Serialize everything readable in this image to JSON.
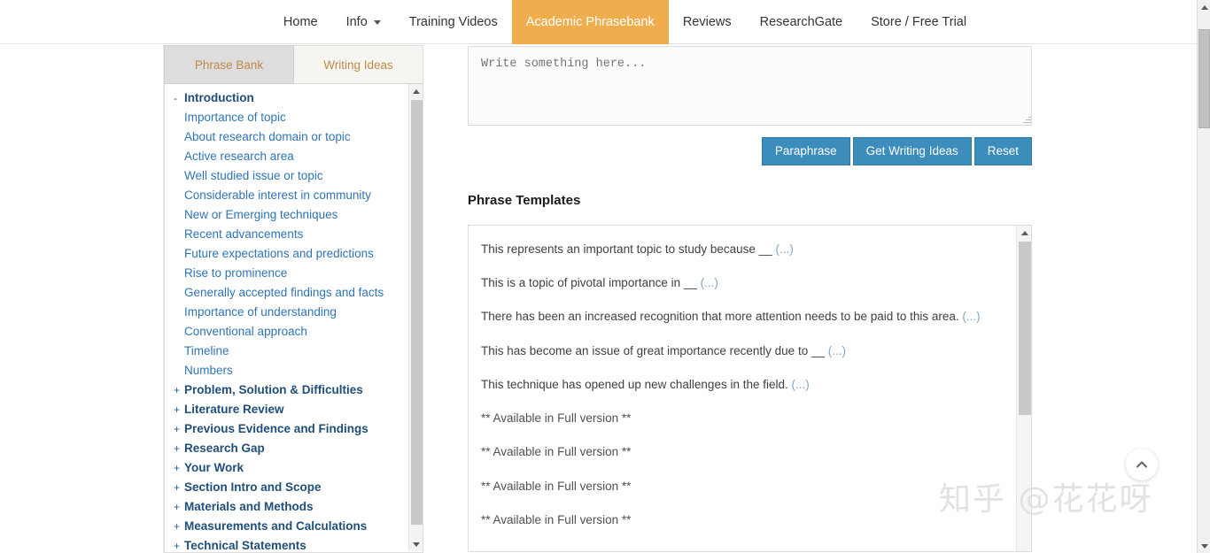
{
  "nav": {
    "items": [
      {
        "label": "Home",
        "active": false,
        "has_caret": false
      },
      {
        "label": "Info",
        "active": false,
        "has_caret": true
      },
      {
        "label": "Training Videos",
        "active": false,
        "has_caret": false
      },
      {
        "label": "Academic Phrasebank",
        "active": true,
        "has_caret": false
      },
      {
        "label": "Reviews",
        "active": false,
        "has_caret": false
      },
      {
        "label": "ResearchGate",
        "active": false,
        "has_caret": false
      },
      {
        "label": "Store / Free Trial",
        "active": false,
        "has_caret": false
      }
    ],
    "active_color": "#F0AD4E"
  },
  "sidebar": {
    "tabs": [
      {
        "label": "Phrase Bank",
        "active": true
      },
      {
        "label": "Writing Ideas",
        "active": false
      }
    ],
    "items": [
      {
        "label": "Introduction",
        "type": "group",
        "marker": "-"
      },
      {
        "label": "Importance of topic",
        "type": "child",
        "marker": ""
      },
      {
        "label": "About research domain or topic",
        "type": "child",
        "marker": ""
      },
      {
        "label": "Active research area",
        "type": "child",
        "marker": ""
      },
      {
        "label": "Well studied issue or topic",
        "type": "child",
        "marker": ""
      },
      {
        "label": "Considerable interest in community",
        "type": "child",
        "marker": ""
      },
      {
        "label": "New or Emerging techniques",
        "type": "child",
        "marker": ""
      },
      {
        "label": "Recent advancements",
        "type": "child",
        "marker": ""
      },
      {
        "label": "Future expectations and predictions",
        "type": "child",
        "marker": ""
      },
      {
        "label": "Rise to prominence",
        "type": "child",
        "marker": ""
      },
      {
        "label": "Generally accepted findings and facts",
        "type": "child",
        "marker": ""
      },
      {
        "label": "Importance of understanding",
        "type": "child",
        "marker": ""
      },
      {
        "label": "Conventional approach",
        "type": "child",
        "marker": ""
      },
      {
        "label": "Timeline",
        "type": "child",
        "marker": ""
      },
      {
        "label": "Numbers",
        "type": "child",
        "marker": ""
      },
      {
        "label": "Problem, Solution & Difficulties",
        "type": "group",
        "marker": "+"
      },
      {
        "label": "Literature Review",
        "type": "group",
        "marker": "+"
      },
      {
        "label": "Previous Evidence and Findings",
        "type": "group",
        "marker": "+"
      },
      {
        "label": "Research Gap",
        "type": "group",
        "marker": "+"
      },
      {
        "label": "Your Work",
        "type": "group",
        "marker": "+"
      },
      {
        "label": "Section Intro and Scope",
        "type": "group",
        "marker": "+"
      },
      {
        "label": "Materials and Methods",
        "type": "group",
        "marker": "+"
      },
      {
        "label": "Measurements and Calculations",
        "type": "group",
        "marker": "+"
      },
      {
        "label": "Technical Statements",
        "type": "group",
        "marker": "+"
      }
    ]
  },
  "editor": {
    "placeholder": "Write something here...",
    "value": ""
  },
  "buttons": [
    {
      "label": "Paraphrase"
    },
    {
      "label": "Get Writing Ideas"
    },
    {
      "label": "Reset"
    }
  ],
  "button_color": "#3C8DBC",
  "phrase_panel": {
    "title": "Phrase Templates",
    "items": [
      {
        "text": "This represents an important topic to study because __",
        "more": "(...)"
      },
      {
        "text": "This is a topic of pivotal importance in __",
        "more": "(...)"
      },
      {
        "text": "There has been an increased recognition that more attention needs to be paid to this area.",
        "more": "(...)"
      },
      {
        "text": "This has become an issue of great importance recently due to __",
        "more": "(...)"
      },
      {
        "text": "This technique has opened up new challenges in the field.",
        "more": "(...)"
      },
      {
        "text": "** Available in Full version **",
        "more": ""
      },
      {
        "text": "** Available in Full version **",
        "more": ""
      },
      {
        "text": "** Available in Full version **",
        "more": ""
      },
      {
        "text": "** Available in Full version **",
        "more": ""
      }
    ]
  },
  "watermark": {
    "text": "知乎 @花花呀"
  },
  "scroll_top": {
    "label": "scroll-to-top"
  }
}
